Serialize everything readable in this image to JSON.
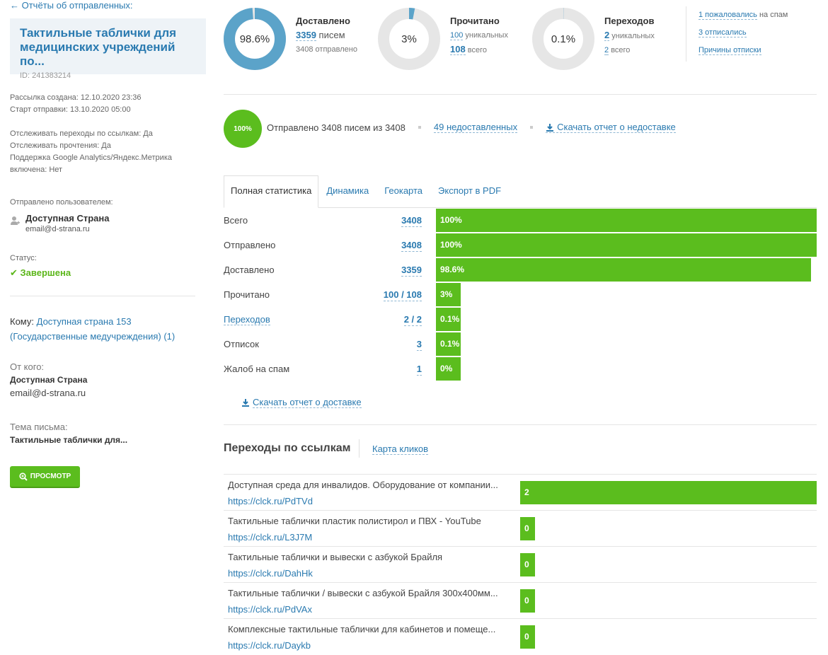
{
  "sidebar": {
    "back_link": "← Отчёты об отправленных:",
    "campaign_title": "Тактильные таблички для медицинских учреждений по...",
    "campaign_id": "ID: 241383214",
    "created": "Рассылка создана: 12.10.2020 23:36",
    "start": "Старт отправки: 13.10.2020 05:00",
    "track_clicks": "Отслеживать переходы по ссылкам: Да",
    "track_opens": "Отслеживать прочтения: Да",
    "analytics_support": "Поддержка Google Analytics/Яндекс.Метрика",
    "analytics_enabled": "включена: Нет",
    "sent_by_label": "Отправлено пользователем:",
    "sent_by_name": "Доступная Страна",
    "sent_by_email": "email@d-strana.ru",
    "status_label": "Статус:",
    "status_value": "Завершена",
    "to_label": "Кому:",
    "to_link": "Доступная страна 153 (Государственные медучреждения) (1)",
    "from_label": "От кого:",
    "from_name": "Доступная Страна",
    "from_email": "email@d-strana.ru",
    "subject_label": "Тема письма:",
    "subject_value": "Тактильные таблички для...",
    "preview_button": "ПРОСМОТР"
  },
  "summary": {
    "delivered": {
      "percent_label": "98.6%",
      "percent": 98.6,
      "title": "Доставлено",
      "count": "3359",
      "count_suffix": "писем",
      "sent_line": "3408 отправлено"
    },
    "read": {
      "percent_label": "3%",
      "percent": 3,
      "title": "Прочитано",
      "unique": "100",
      "unique_suffix": "уникальных",
      "total": "108",
      "total_suffix": "всего"
    },
    "clicks": {
      "percent_label": "0.1%",
      "percent": 0.1,
      "title": "Переходов",
      "unique": "2",
      "unique_suffix": "уникальных",
      "total": "2",
      "total_suffix": "всего"
    },
    "side_links": {
      "spam_link": "1 пожаловались",
      "spam_suffix": "на спам",
      "unsub_link": "3 отписались",
      "reasons_link": "Причины отписки"
    }
  },
  "progress": {
    "percent_label": "100%",
    "sent_text": "Отправлено 3408 писем из 3408",
    "undelivered_link": "49 недоставленных",
    "download_undelivered": "Скачать отчет о недоставке"
  },
  "tabs": [
    "Полная статистика",
    "Динамика",
    "Геокарта",
    "Экспорт в PDF"
  ],
  "stats": [
    {
      "label": "Всего",
      "value": "3408",
      "bar_label": "100%",
      "fraction": 1.0,
      "label_is_link": false
    },
    {
      "label": "Отправлено",
      "value": "3408",
      "bar_label": "100%",
      "fraction": 1.0,
      "label_is_link": false
    },
    {
      "label": "Доставлено",
      "value": "3359",
      "bar_label": "98.6%",
      "fraction": 0.986,
      "label_is_link": false
    },
    {
      "label": "Прочитано",
      "value": "100 / 108",
      "bar_label": "3%",
      "fraction": 0.03,
      "label_is_link": false
    },
    {
      "label": "Переходов",
      "value": "2 / 2",
      "bar_label": "0.1%",
      "fraction": 0.001,
      "label_is_link": true
    },
    {
      "label": "Отписок",
      "value": "3",
      "bar_label": "0.1%",
      "fraction": 0.001,
      "label_is_link": false
    },
    {
      "label": "Жалоб на спам",
      "value": "1",
      "bar_label": "0%",
      "fraction": 0.0,
      "label_is_link": false
    }
  ],
  "download_delivery": "Скачать отчет о доставке",
  "clicks_section": {
    "title": "Переходы по ссылкам",
    "click_map_link": "Карта кликов",
    "links": [
      {
        "title": "Доступная среда для инвалидов. Оборудование от компании...",
        "url": "https://clck.ru/PdTVd",
        "count": "2",
        "fraction": 1.0
      },
      {
        "title": "Тактильные таблички пластик полистирол и ПВХ - YouTube",
        "url": "https://clck.ru/L3J7M",
        "count": "0",
        "fraction": 0
      },
      {
        "title": "Тактильные таблички и вывески с азбукой Брайля",
        "url": "https://clck.ru/DahHk",
        "count": "0",
        "fraction": 0
      },
      {
        "title": "Тактильные таблички / вывески с азбукой Брайля 300х400мм...",
        "url": "https://clck.ru/PdVAx",
        "count": "0",
        "fraction": 0
      },
      {
        "title": "Комплексные тактильные таблички для кабинетов и помеще...",
        "url": "https://clck.ru/Daykb",
        "count": "0",
        "fraction": 0
      }
    ]
  },
  "colors": {
    "green": "#5bbd1e",
    "blue_donut": "#5ba3c9",
    "donut_track": "#e6e6e6",
    "link": "#2a7ab0"
  }
}
